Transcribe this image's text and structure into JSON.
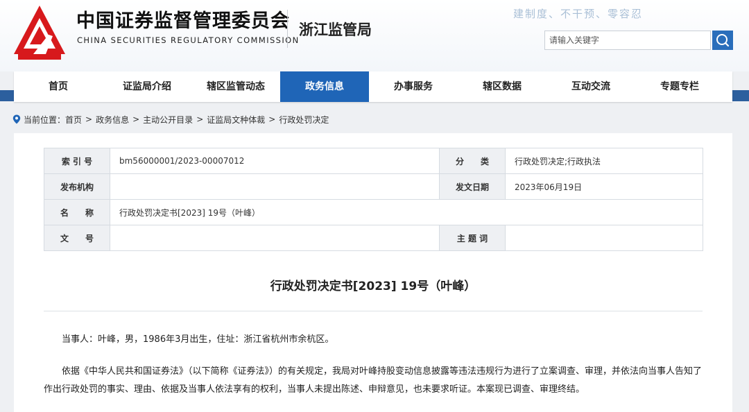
{
  "header": {
    "org_name_cn": "中国证券监督管理委员会",
    "org_name_en": "CHINA SECURITIES REGULATORY COMMISSION",
    "bureau": "浙江监管局",
    "slogan": "建制度、不干预、零容忍",
    "search": {
      "placeholder": "请输入关键字"
    },
    "colors": {
      "brand_red": "#d7191c",
      "accent_blue": "#1f65b7"
    }
  },
  "nav": {
    "items": [
      {
        "label": "首页"
      },
      {
        "label": "证监局介绍"
      },
      {
        "label": "辖区监管动态"
      },
      {
        "label": "政务信息",
        "active": true
      },
      {
        "label": "办事服务"
      },
      {
        "label": "辖区数据"
      },
      {
        "label": "互动交流"
      },
      {
        "label": "专题专栏"
      }
    ]
  },
  "breadcrumb": {
    "prefix": "当前位置：",
    "items": [
      "首页",
      "政务信息",
      "主动公开目录",
      "证监局文种体裁",
      "行政处罚决定"
    ],
    "separator": ">"
  },
  "meta": {
    "index_label": "索 引 号",
    "index_value": "bm56000001/2023-00007012",
    "category_label": "分　　类",
    "category_value": "行政处罚决定;行政执法",
    "issuer_label": "发布机构",
    "issuer_value": "",
    "date_label": "发文日期",
    "date_value": "2023年06月19日",
    "name_label": "名　　称",
    "name_value": "行政处罚决定书[2023] 19号（叶峰）",
    "docno_label": "文　　号",
    "docno_value": "",
    "keywords_label": "主 题 词",
    "keywords_value": ""
  },
  "document": {
    "title": "行政处罚决定书[2023] 19号（叶峰）",
    "paragraphs": [
      "当事人：叶峰，男，1986年3月出生，住址：浙江省杭州市余杭区。",
      "依据《中华人民共和国证券法》（以下简称《证券法》）的有关规定，我局对叶峰持股变动信息披露等违法违规行为进行了立案调查、审理，并依法向当事人告知了作出行政处罚的事实、理由、依据及当事人依法享有的权利，当事人未提出陈述、申辩意见，也未要求听证。本案现已调查、审理终结。"
    ]
  }
}
